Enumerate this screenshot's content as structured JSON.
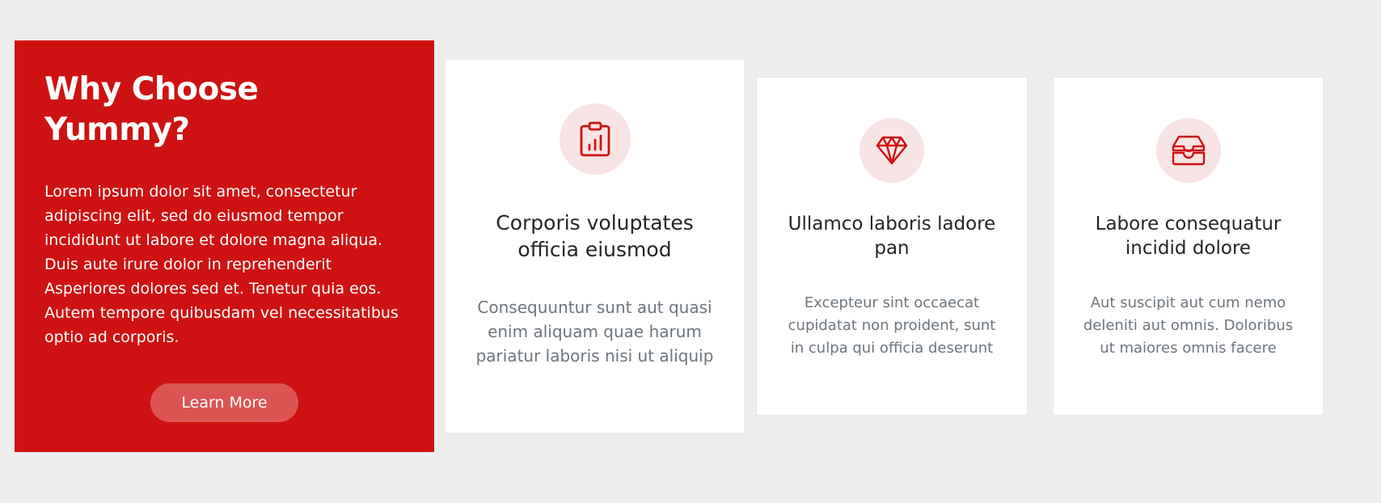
{
  "why": {
    "title": "Why Choose Yummy?",
    "text": "Lorem ipsum dolor sit amet, consectetur adipiscing elit, sed do eiusmod tempor incididunt ut labore et dolore magna aliqua. Duis aute irure dolor in reprehenderit Asperiores dolores sed et. Tenetur quia eos. Autem tempore quibusdam vel necessitatibus optio ad corporis.",
    "button_label": "Learn More"
  },
  "cards": [
    {
      "icon": "clipboard-data-icon",
      "title": "Corporis voluptates officia eiusmod",
      "description": "Consequuntur sunt aut quasi enim aliquam quae harum pariatur laboris nisi ut aliquip"
    },
    {
      "icon": "gem-icon",
      "title": "Ullamco laboris ladore pan",
      "description": "Excepteur sint occaecat cupidatat non proident, sunt in culpa qui officia deserunt"
    },
    {
      "icon": "inboxes-icon",
      "title": "Labore consequatur incidid dolore",
      "description": "Aut suscipit aut cum nemo deleniti aut omnis. Doloribus ut maiores omnis facere"
    }
  ],
  "colors": {
    "accent": "#ce1212",
    "icon_bg": "#f8e4e4",
    "page_bg": "#eeeeee",
    "title_text": "#212529",
    "muted_text": "#6c757d"
  }
}
